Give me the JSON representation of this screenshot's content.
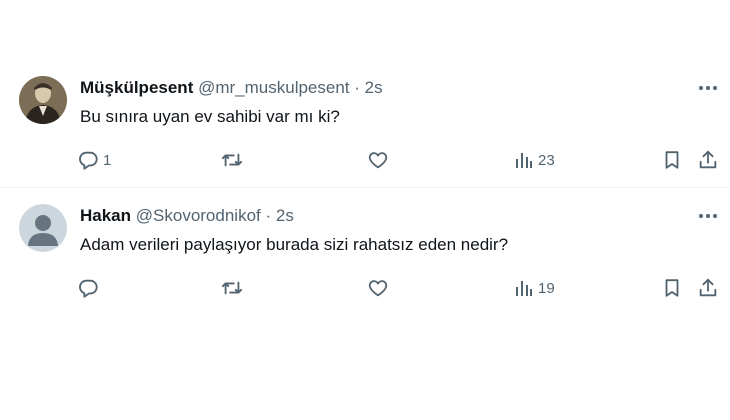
{
  "colors": {
    "text": "#0f1419",
    "secondary": "#536471",
    "divider": "#eff3f4",
    "default_avatar_bg": "#ccd6dd"
  },
  "tweets": [
    {
      "name": "Müşkülpesent",
      "handle": "@mr_muskulpesent",
      "separator": "·",
      "time": "2s",
      "text": "Bu sınıra uyan ev sahibi var mı ki?",
      "reply_count": "1",
      "views": "23",
      "icons": [
        "more-icon",
        "reply-icon",
        "retweet-icon",
        "like-icon",
        "views-icon",
        "bookmark-icon",
        "share-icon"
      ]
    },
    {
      "name": "Hakan",
      "handle": "@Skovorodnikof",
      "separator": "·",
      "time": "2s",
      "text": "Adam verileri paylaşıyor burada sizi rahatsız eden nedir?",
      "reply_count": "",
      "views": "19",
      "icons": [
        "more-icon",
        "reply-icon",
        "retweet-icon",
        "like-icon",
        "views-icon",
        "bookmark-icon",
        "share-icon"
      ]
    }
  ]
}
